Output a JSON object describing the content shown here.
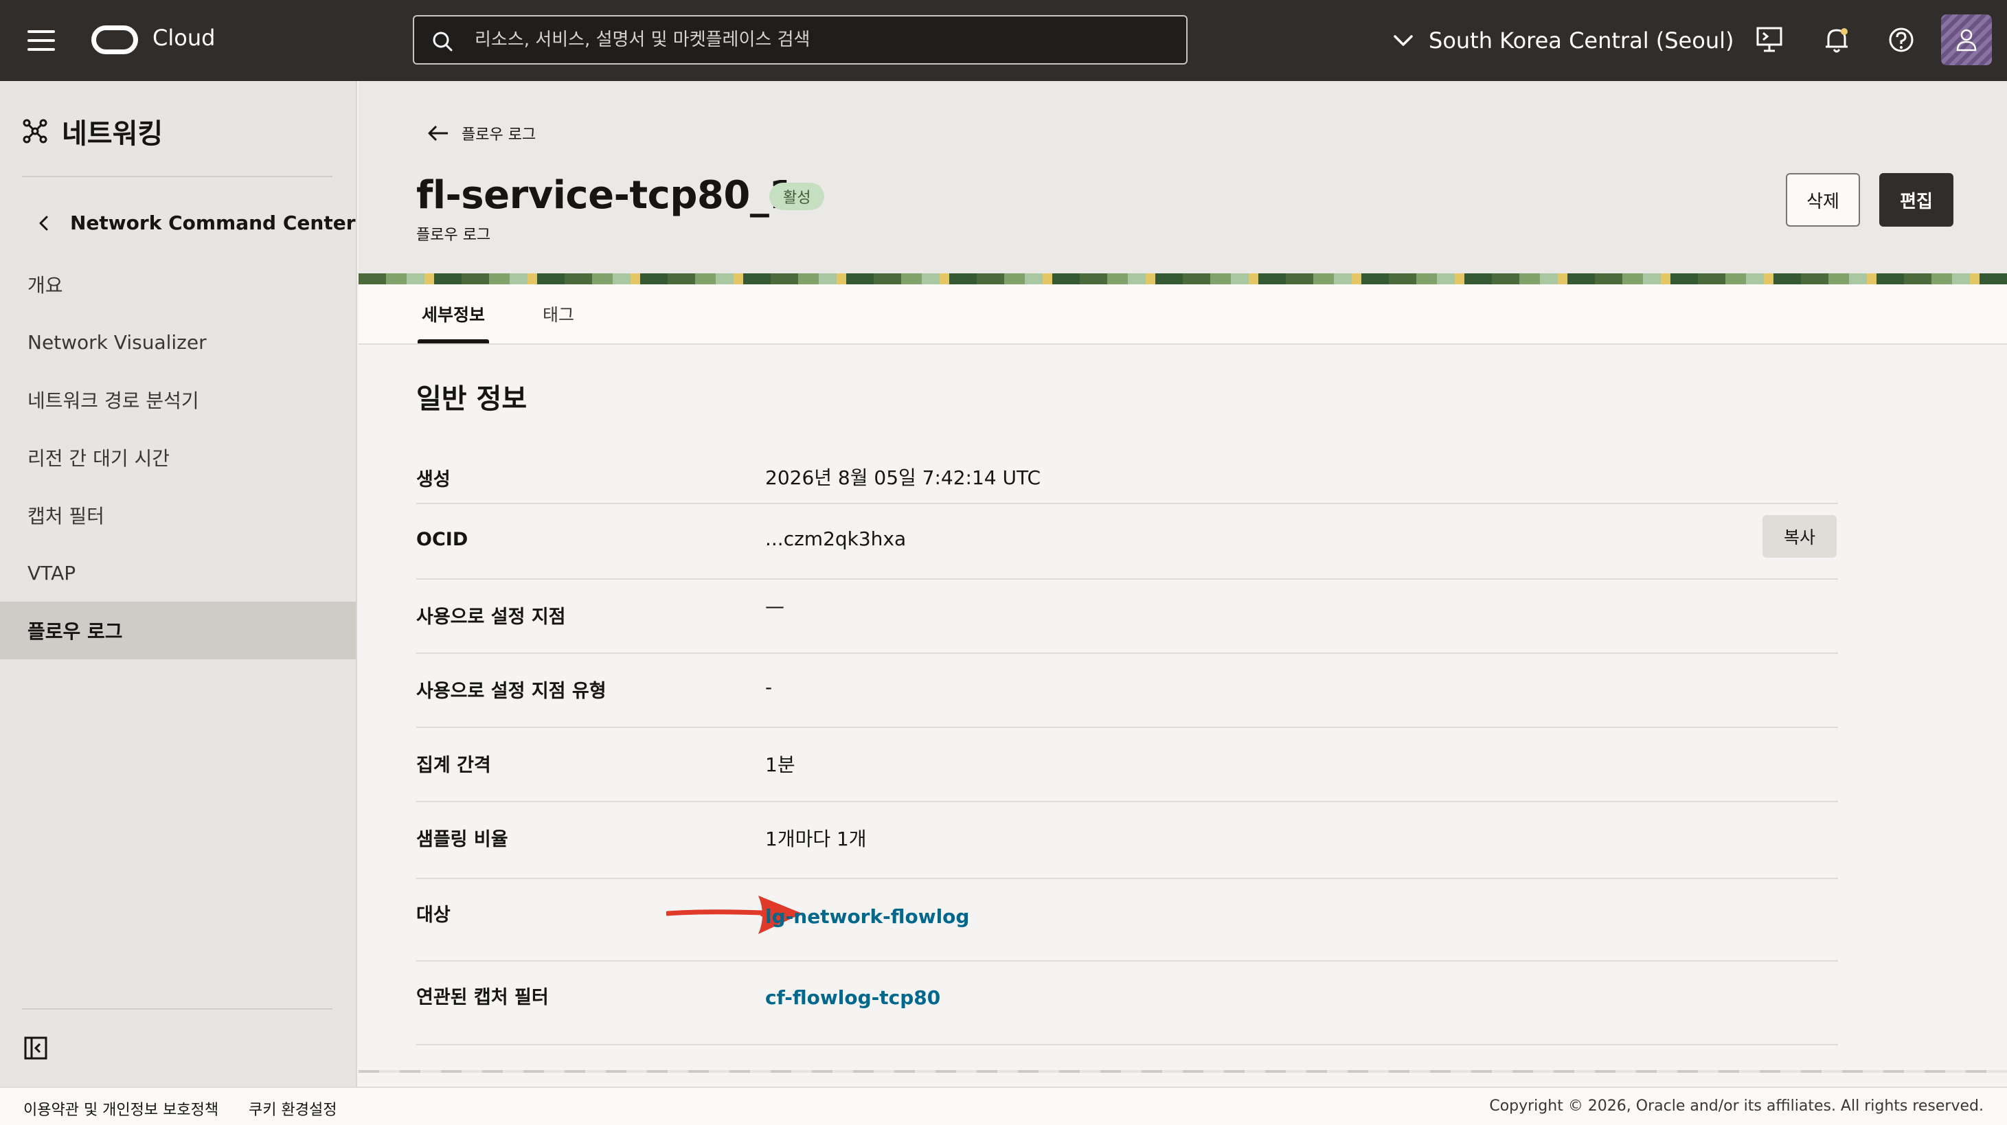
{
  "topbar": {
    "brand": "Cloud",
    "search_placeholder": "리소스, 서비스, 설명서 및 마켓플레이스 검색",
    "region": "South Korea Central (Seoul)"
  },
  "sidebar": {
    "title": "네트워킹",
    "back_label": "Network Command Center",
    "items": [
      {
        "label": "개요"
      },
      {
        "label": "Network Visualizer"
      },
      {
        "label": "네트워크 경로 분석기"
      },
      {
        "label": "리전 간 대기 시간"
      },
      {
        "label": "캡처 필터"
      },
      {
        "label": "VTAP"
      },
      {
        "label": "플로우 로그"
      }
    ]
  },
  "header": {
    "breadcrumb": "플로우 로그",
    "title": "fl-service-tcp80_1",
    "status": "활성",
    "subtitle": "플로우 로그",
    "delete_label": "삭제",
    "edit_label": "편집"
  },
  "tabs": [
    {
      "label": "세부정보"
    },
    {
      "label": "태그"
    }
  ],
  "details": {
    "section_title": "일반 정보",
    "copy_label": "복사",
    "rows": [
      {
        "label": "생성",
        "value": "2026년 8월 05일 7:42:14 UTC"
      },
      {
        "label": "OCID",
        "value": "...czm2qk3hxa"
      },
      {
        "label": "사용으로 설정 지점",
        "value": "—"
      },
      {
        "label": "사용으로 설정 지점 유형",
        "value": "-"
      },
      {
        "label": "집계 간격",
        "value": "1분"
      },
      {
        "label": "샘플링 비율",
        "value": "1개마다 1개"
      },
      {
        "label": "대상",
        "value": "lg-network-flowlog"
      },
      {
        "label": "연관된 캡처 필터",
        "value": "cf-flowlog-tcp80"
      }
    ]
  },
  "footer": {
    "terms": "이용약관 및 개인정보 보호정책",
    "cookies": "쿠키 환경설정",
    "copyright": "Copyright © 2026, Oracle and/or its affiliates. All rights reserved."
  },
  "colors": {
    "topbar": "#312d2a",
    "link": "#00688c",
    "status_badge": "#c7dfc1",
    "annotation_arrow": "#e03a2a"
  }
}
